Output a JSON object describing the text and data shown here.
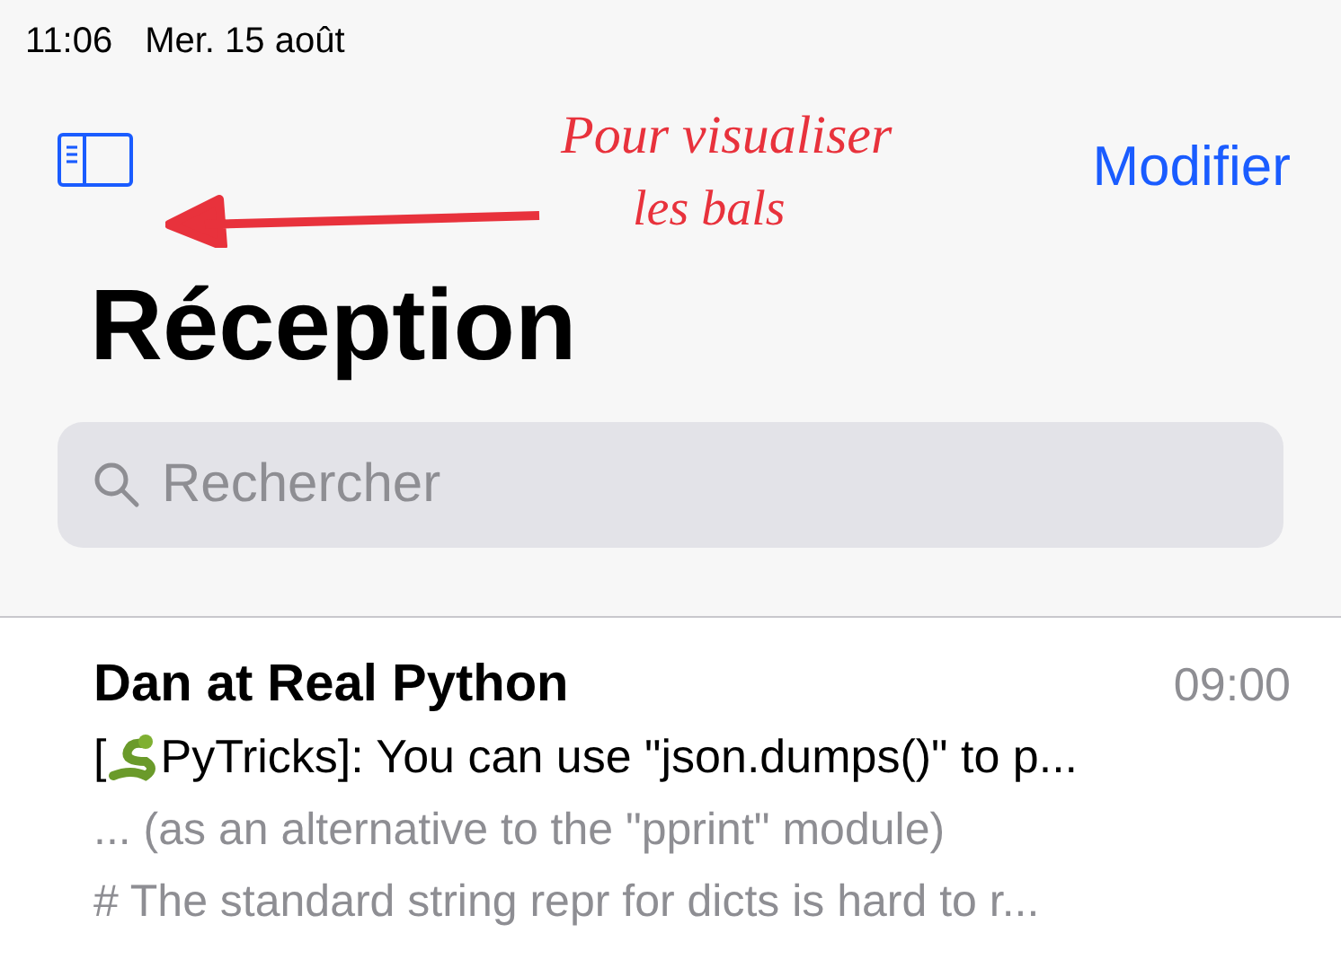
{
  "status_bar": {
    "time": "11:06",
    "date": "Mer. 15 août"
  },
  "nav": {
    "edit_button": "Modifier"
  },
  "annotation": {
    "lines": [
      "Pour visualiser",
      "les bals"
    ]
  },
  "title": "Réception",
  "search": {
    "placeholder": "Rechercher"
  },
  "messages": [
    {
      "sender": "Dan at Real Python",
      "time": "09:00",
      "subject_prefix": "[",
      "subject": "PyTricks]: You can use \"json.dumps()\" to p...",
      "preview": [
        "... (as an alternative to the \"pprint\" module)",
        "# The standard string repr for dicts is hard to r..."
      ]
    }
  ]
}
